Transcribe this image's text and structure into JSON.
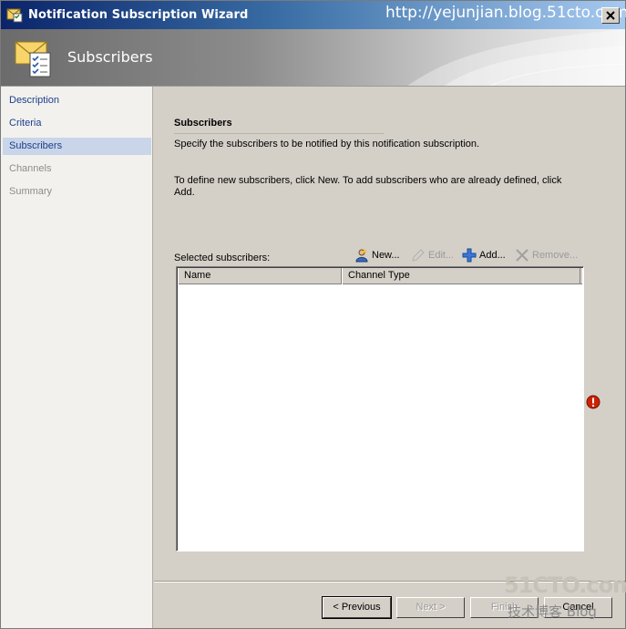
{
  "window": {
    "title": "Notification Subscription Wizard",
    "watermark_url": "http://yejunjian.blog.51cto.com"
  },
  "banner": {
    "title": "Subscribers"
  },
  "nav": {
    "items": [
      {
        "label": "Description",
        "state": "link"
      },
      {
        "label": "Criteria",
        "state": "link"
      },
      {
        "label": "Subscribers",
        "state": "selected"
      },
      {
        "label": "Channels",
        "state": "disabled"
      },
      {
        "label": "Summary",
        "state": "disabled"
      }
    ]
  },
  "page": {
    "section_title": "Subscribers",
    "description": "Specify the subscribers to be notified by this notification subscription.",
    "instructions": "To define new subscribers, click New.  To add subscribers who are already defined, click Add.",
    "selected_label": "Selected subscribers:"
  },
  "toolbar": {
    "new_label": "New...",
    "edit_label": "Edit...",
    "add_label": "Add...",
    "remove_label": "Remove..."
  },
  "table": {
    "columns": [
      "Name",
      "Channel Type"
    ],
    "rows": []
  },
  "buttons": {
    "previous": "< Previous",
    "next": "Next >",
    "finish": "Finish",
    "cancel": "Cancel"
  },
  "watermark": {
    "main": "51CTO.com",
    "sub": "技术博客",
    "blog": "Blog"
  },
  "colors": {
    "title_bar": "#0a246a",
    "nav_link": "#1c3f8c",
    "nav_selected_bg": "#c9d5e8",
    "error": "#cc2200"
  }
}
